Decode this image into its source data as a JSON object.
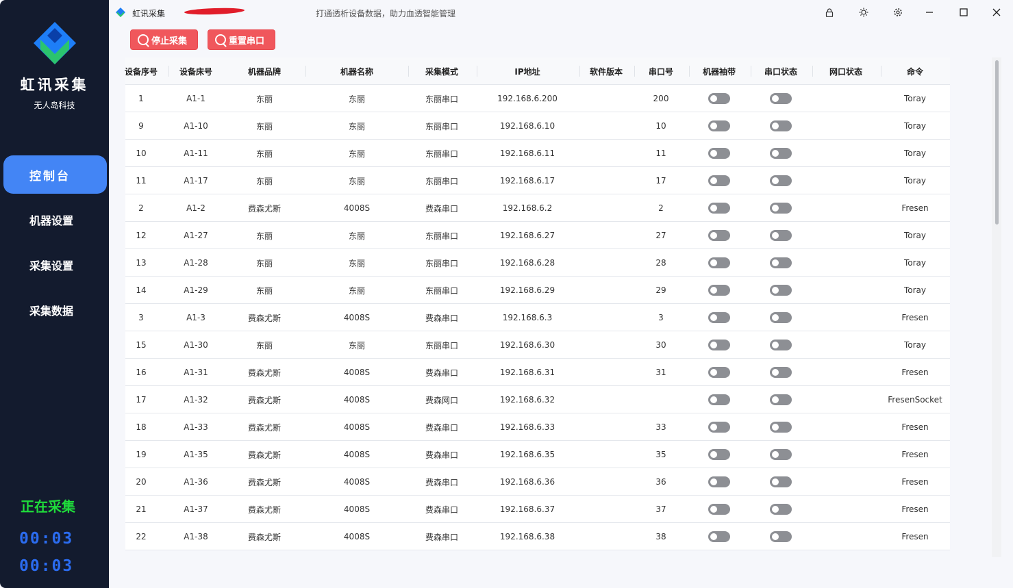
{
  "window": {
    "app_title": "虹讯采集",
    "slogan": "打通透析设备数据，助力血透智能管理"
  },
  "sidebar": {
    "brand": "虹讯采集",
    "company": "无人岛科技",
    "nav": [
      {
        "label": "控制台",
        "active": true
      },
      {
        "label": "机器设置",
        "active": false
      },
      {
        "label": "采集设置",
        "active": false
      },
      {
        "label": "采集数据",
        "active": false
      }
    ],
    "status": "正在采集",
    "timer1": "00:03",
    "timer2": "00:03"
  },
  "toolbar": {
    "stop_label": "停止采集",
    "reset_label": "重置串口"
  },
  "table": {
    "columns": [
      "设备序号",
      "设备床号",
      "机器品牌",
      "机器名称",
      "采集模式",
      "IP地址",
      "软件版本",
      "串口号",
      "机器袖带",
      "串口状态",
      "网口状态",
      "命令"
    ],
    "rows": [
      {
        "seq": "1",
        "bed": "A1-1",
        "brand": "东丽",
        "name": "东丽",
        "mode": "东丽串口",
        "ip": "192.168.6.200",
        "ver": "",
        "port": "200",
        "cmd": "Toray"
      },
      {
        "seq": "9",
        "bed": "A1-10",
        "brand": "东丽",
        "name": "东丽",
        "mode": "东丽串口",
        "ip": "192.168.6.10",
        "ver": "",
        "port": "10",
        "cmd": "Toray"
      },
      {
        "seq": "10",
        "bed": "A1-11",
        "brand": "东丽",
        "name": "东丽",
        "mode": "东丽串口",
        "ip": "192.168.6.11",
        "ver": "",
        "port": "11",
        "cmd": "Toray"
      },
      {
        "seq": "11",
        "bed": "A1-17",
        "brand": "东丽",
        "name": "东丽",
        "mode": "东丽串口",
        "ip": "192.168.6.17",
        "ver": "",
        "port": "17",
        "cmd": "Toray"
      },
      {
        "seq": "2",
        "bed": "A1-2",
        "brand": "费森尤斯",
        "name": "4008S",
        "mode": "费森串口",
        "ip": "192.168.6.2",
        "ver": "",
        "port": "2",
        "cmd": "Fresen"
      },
      {
        "seq": "12",
        "bed": "A1-27",
        "brand": "东丽",
        "name": "东丽",
        "mode": "东丽串口",
        "ip": "192.168.6.27",
        "ver": "",
        "port": "27",
        "cmd": "Toray"
      },
      {
        "seq": "13",
        "bed": "A1-28",
        "brand": "东丽",
        "name": "东丽",
        "mode": "东丽串口",
        "ip": "192.168.6.28",
        "ver": "",
        "port": "28",
        "cmd": "Toray"
      },
      {
        "seq": "14",
        "bed": "A1-29",
        "brand": "东丽",
        "name": "东丽",
        "mode": "东丽串口",
        "ip": "192.168.6.29",
        "ver": "",
        "port": "29",
        "cmd": "Toray"
      },
      {
        "seq": "3",
        "bed": "A1-3",
        "brand": "费森尤斯",
        "name": "4008S",
        "mode": "费森串口",
        "ip": "192.168.6.3",
        "ver": "",
        "port": "3",
        "cmd": "Fresen"
      },
      {
        "seq": "15",
        "bed": "A1-30",
        "brand": "东丽",
        "name": "东丽",
        "mode": "东丽串口",
        "ip": "192.168.6.30",
        "ver": "",
        "port": "30",
        "cmd": "Toray"
      },
      {
        "seq": "16",
        "bed": "A1-31",
        "brand": "费森尤斯",
        "name": "4008S",
        "mode": "费森串口",
        "ip": "192.168.6.31",
        "ver": "",
        "port": "31",
        "cmd": "Fresen"
      },
      {
        "seq": "17",
        "bed": "A1-32",
        "brand": "费森尤斯",
        "name": "4008S",
        "mode": "费森网口",
        "ip": "192.168.6.32",
        "ver": "",
        "port": "",
        "cmd": "FresenSocket"
      },
      {
        "seq": "18",
        "bed": "A1-33",
        "brand": "费森尤斯",
        "name": "4008S",
        "mode": "费森串口",
        "ip": "192.168.6.33",
        "ver": "",
        "port": "33",
        "cmd": "Fresen"
      },
      {
        "seq": "19",
        "bed": "A1-35",
        "brand": "费森尤斯",
        "name": "4008S",
        "mode": "费森串口",
        "ip": "192.168.6.35",
        "ver": "",
        "port": "35",
        "cmd": "Fresen"
      },
      {
        "seq": "20",
        "bed": "A1-36",
        "brand": "费森尤斯",
        "name": "4008S",
        "mode": "费森串口",
        "ip": "192.168.6.36",
        "ver": "",
        "port": "36",
        "cmd": "Fresen"
      },
      {
        "seq": "21",
        "bed": "A1-37",
        "brand": "费森尤斯",
        "name": "4008S",
        "mode": "费森串口",
        "ip": "192.168.6.37",
        "ver": "",
        "port": "37",
        "cmd": "Fresen"
      },
      {
        "seq": "22",
        "bed": "A1-38",
        "brand": "费森尤斯",
        "name": "4008S",
        "mode": "费森串口",
        "ip": "192.168.6.38",
        "ver": "",
        "port": "38",
        "cmd": "Fresen"
      }
    ]
  },
  "icons": {
    "lock": "lock-icon",
    "theme": "sun-icon",
    "settings": "gear-icon",
    "minimize": "minimize-icon",
    "maximize": "maximize-icon",
    "close": "close-icon"
  },
  "colors": {
    "sidebar_bg": "#131b2e",
    "nav_active": "#4385f5",
    "button_red": "#f0575c",
    "status_green": "#1fdc3b",
    "timer_blue": "#2b6cf0"
  }
}
